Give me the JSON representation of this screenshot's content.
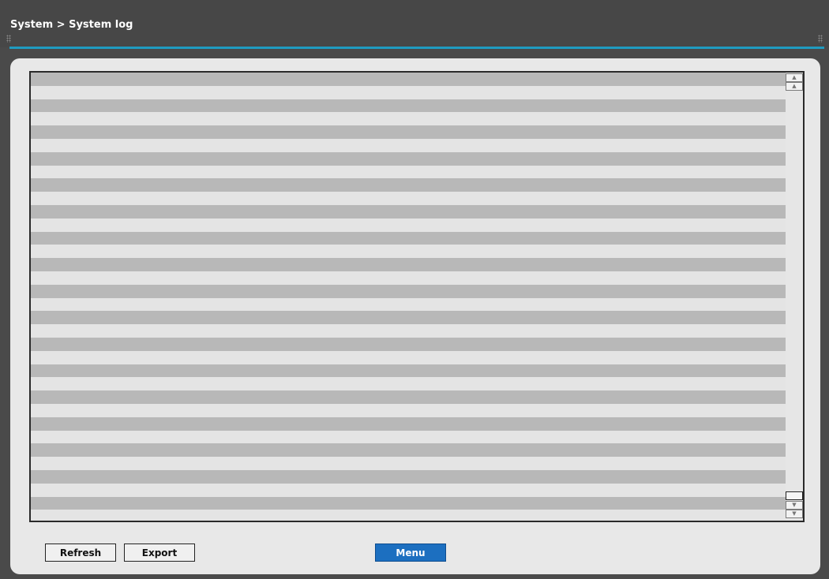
{
  "header": {
    "breadcrumb": "System > System log"
  },
  "log": {
    "rows": [
      "",
      "",
      "",
      "",
      "",
      "",
      "",
      "",
      "",
      "",
      "",
      "",
      "",
      "",
      "",
      "",
      "",
      "",
      "",
      "",
      "",
      "",
      "",
      "",
      "",
      "",
      "",
      "",
      "",
      "",
      "",
      "",
      "",
      ""
    ]
  },
  "scrollbar": {
    "top_icon": "scroll-top-icon",
    "up_icon": "scroll-up-icon",
    "down_icon": "scroll-down-icon",
    "bottom_icon": "scroll-bottom-icon"
  },
  "footer": {
    "refresh_label": "Refresh",
    "export_label": "Export",
    "menu_label": "Menu"
  },
  "colors": {
    "accent": "#1f9bc0",
    "menu_button": "#1c6fc0",
    "titlebar": "#474747",
    "row_dark": "#b8b8b8",
    "row_light": "#e4e4e4"
  }
}
